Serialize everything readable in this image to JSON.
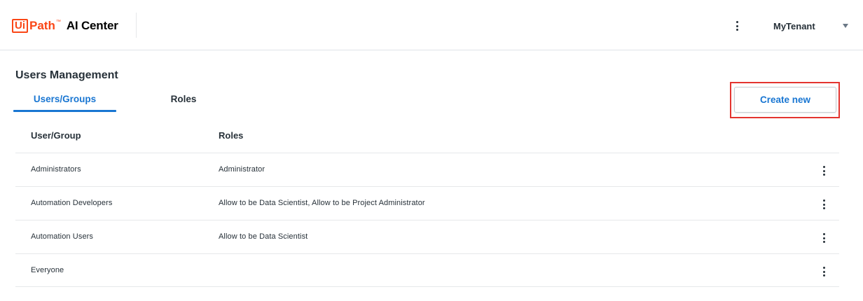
{
  "header": {
    "logo_ui": "Ui",
    "logo_path": "Path",
    "logo_tm": "™",
    "product": "AI Center",
    "more_icon": "vertical-ellipsis-icon",
    "tenant": "MyTenant",
    "tenant_caret_icon": "caret-down-icon"
  },
  "page": {
    "title": "Users Management",
    "tabs": [
      {
        "label": "Users/Groups",
        "active": true
      },
      {
        "label": "Roles",
        "active": false
      }
    ],
    "create_button": "Create new"
  },
  "table": {
    "columns": [
      "User/Group",
      "Roles"
    ],
    "rows": [
      {
        "user": "Administrators",
        "roles": "Administrator"
      },
      {
        "user": "Automation Developers",
        "roles": "Allow to be Data Scientist, Allow to be Project Administrator"
      },
      {
        "user": "Automation Users",
        "roles": "Allow to be Data Scientist"
      },
      {
        "user": "Everyone",
        "roles": ""
      }
    ],
    "row_action_icon": "vertical-ellipsis-icon"
  },
  "colors": {
    "brand": "#fa4616",
    "accent": "#1976d2",
    "highlight": "#e3342f"
  }
}
